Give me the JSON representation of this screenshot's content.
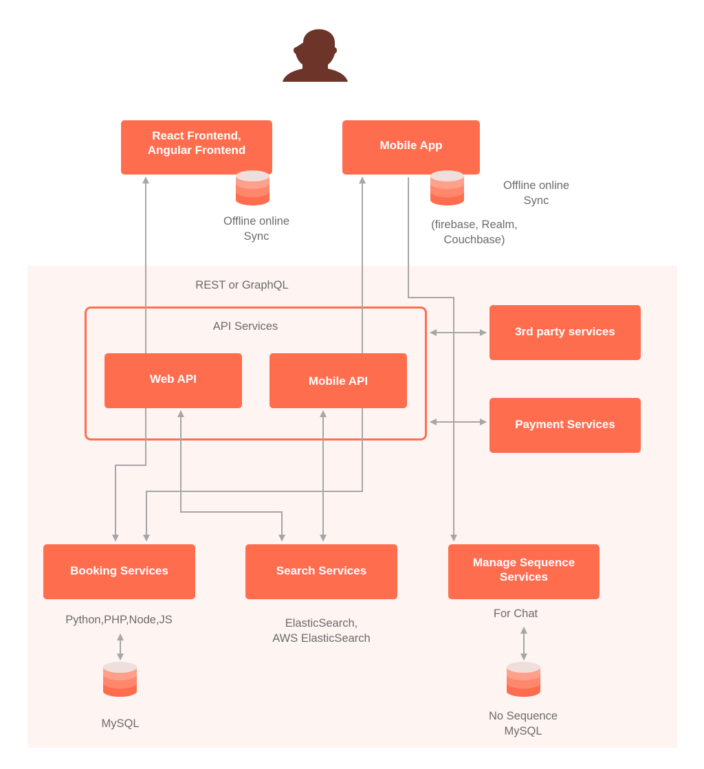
{
  "colors": {
    "box_fill": "#ff6d4f",
    "box_text": "#ffffff",
    "user_icon": "#6d3429",
    "zone_bg": "#fef4f2",
    "connector": "#a6a6a6",
    "label_text": "#6b6b6b",
    "db_top": "#eedfdc",
    "db_band1": "#ffa08a",
    "db_band2": "#ff876b",
    "db_band3": "#ff6d4f"
  },
  "user": {
    "icon": "user-silhouette-icon"
  },
  "clients": {
    "web_frontend": {
      "label": "React Frontend,\nAngular Frontend",
      "db_icon": "database-icon",
      "db_label": "Offline online\nSync"
    },
    "mobile_app": {
      "label": "Mobile App",
      "db_icon": "database-icon",
      "db_label": "Offline online\nSync",
      "db_note": "(firebase, Realm,\nCouchbase)"
    }
  },
  "protocol_label": "REST or GraphQL",
  "api_group": {
    "title": "API Services",
    "web_api": "Web API",
    "mobile_api": "Mobile API"
  },
  "external": {
    "third_party": "3rd party services",
    "payment": "Payment Services"
  },
  "backend": {
    "booking": {
      "label": "Booking Services",
      "tech": "Python,PHP,Node,JS",
      "db_icon": "database-icon",
      "db_label": "MySQL"
    },
    "search": {
      "label": "Search Services",
      "tech": "ElasticSearch,\nAWS ElasticSearch"
    },
    "sequence": {
      "label": "Manage Sequence\nServices",
      "tech": "For Chat",
      "db_icon": "database-icon",
      "db_label": "No Sequence\nMySQL"
    }
  },
  "connections": [
    {
      "from": "web_api",
      "to": "web_frontend",
      "type": "one-way"
    },
    {
      "from": "mobile_api",
      "to": "mobile_app",
      "type": "one-way"
    },
    {
      "from": "mobile_app",
      "to": "sequence",
      "type": "one-way"
    },
    {
      "from": "api_group",
      "to": "third_party",
      "type": "two-way"
    },
    {
      "from": "api_group",
      "to": "payment",
      "type": "two-way"
    },
    {
      "from": "web_api",
      "to": "booking",
      "type": "one-way"
    },
    {
      "from": "mobile_api",
      "to": "booking",
      "type": "one-way"
    },
    {
      "from": "search",
      "to": "web_api",
      "type": "two-way"
    },
    {
      "from": "search",
      "to": "mobile_api",
      "type": "two-way"
    },
    {
      "from": "booking",
      "to": "booking_db",
      "type": "two-way"
    },
    {
      "from": "sequence",
      "to": "sequence_db",
      "type": "two-way"
    }
  ]
}
